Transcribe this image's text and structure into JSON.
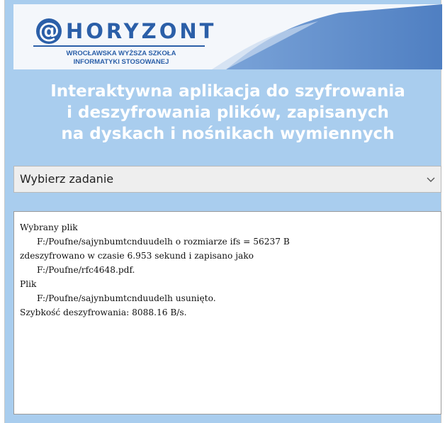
{
  "logo": {
    "at": "@",
    "word": "HORYZONT",
    "line1": "WROCŁAWSKA WYŻSZA SZKOŁA",
    "line2": "INFORMATYKI STOSOWANEJ"
  },
  "title": {
    "line1": "Interaktywna aplikacja do szyfrowania",
    "line2": "i deszyfrowania plików, zapisanych",
    "line3": "na dyskach i nośnikach wymiennych"
  },
  "task_select": {
    "value": "Wybierz zadanie",
    "icon": "chevron-down-icon"
  },
  "output": {
    "lines": [
      "Wybrany plik",
      "F:/Poufne/sajynbumtcnduudelh o rozmiarze ifs = 56237 B",
      "zdeszyfrowano w czasie 6.953 sekund i zapisano jako",
      "F:/Poufne/rfc4648.pdf.",
      "Plik",
      "F:/Poufne/sajynbumtcnduudelh usunięto.",
      "Szybkość deszyfrowania: 8088.16 B/s."
    ]
  },
  "colors": {
    "window_bg": "#a9cdee",
    "brand_blue": "#2b5fa8"
  }
}
